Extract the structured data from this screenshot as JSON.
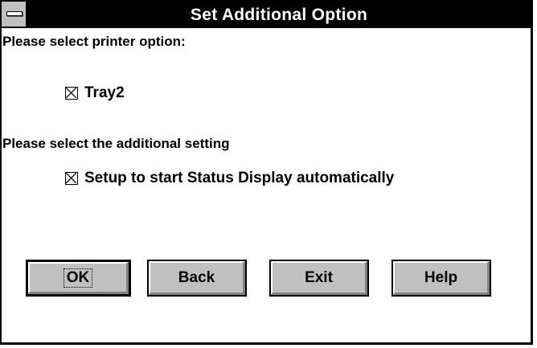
{
  "dialog": {
    "title": "Set Additional Option",
    "printer_prompt": "Please select printer option:",
    "tray_option": {
      "label": "Tray2",
      "checked": true
    },
    "setting_prompt": "Please select the additional setting",
    "status_option": {
      "label": "Setup to start Status Display automatically",
      "checked": true
    },
    "buttons": {
      "ok": "OK",
      "back": "Back",
      "exit": "Exit",
      "help": "Help"
    }
  },
  "colors": {
    "titlebar": "#000000",
    "title_text": "#ffffff",
    "button_face": "#c0c0c0",
    "window": "#ffffff"
  },
  "icons": {
    "system_menu": "system-menu-icon",
    "checkbox_mark": "checkbox-x-icon"
  }
}
